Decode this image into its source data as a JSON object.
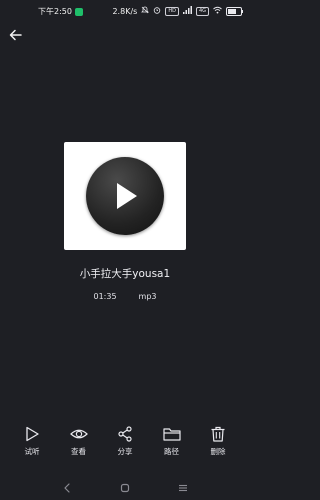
{
  "status_bar": {
    "time": "下午2:50",
    "network_speed": "2.8K/s",
    "icons": [
      "app-notification-icon",
      "mute-icon",
      "alarm-icon",
      "volte-icon",
      "signal-icon",
      "wifi-icon",
      "battery-icon"
    ],
    "badge_hd": "HD",
    "badge_4g": "4G"
  },
  "header": {
    "back_icon": "back-arrow-icon"
  },
  "media": {
    "cover_icon": "play-icon",
    "title": "小手拉大手yousa1",
    "duration": "01:35",
    "format": "mp3"
  },
  "actions": [
    {
      "label": "试听",
      "icon": "play-outline-icon"
    },
    {
      "label": "查看",
      "icon": "eye-icon"
    },
    {
      "label": "分享",
      "icon": "share-icon"
    },
    {
      "label": "路径",
      "icon": "folder-icon"
    },
    {
      "label": "删除",
      "icon": "trash-icon"
    }
  ],
  "nav_bar": {
    "back": "nav-back-icon",
    "home": "nav-home-icon",
    "menu": "nav-menu-icon"
  },
  "colors": {
    "background": "#1e1f24",
    "text": "#e9e9ee",
    "status_app": "#1fbf6a"
  }
}
